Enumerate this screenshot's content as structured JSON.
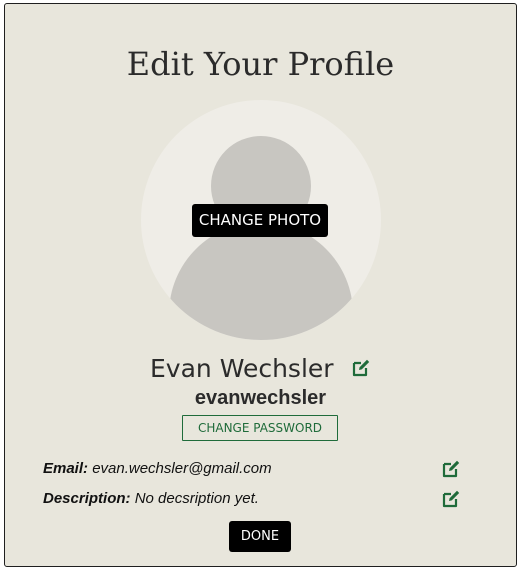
{
  "page": {
    "title": "Edit Your Profile"
  },
  "avatar": {
    "change_photo_label": "CHANGE PHOTO"
  },
  "profile": {
    "full_name": "Evan Wechsler",
    "username": "evanwechsler",
    "change_password_label": "CHANGE PASSWORD"
  },
  "fields": {
    "email_label": "Email:",
    "email_value": "evan.wechsler@gmail.com",
    "description_label": "Description:",
    "description_value": "No decsription yet."
  },
  "actions": {
    "done_label": "DONE"
  },
  "colors": {
    "background": "#e8e6dc",
    "accent_green": "#1f6b3a",
    "button_dark": "#000000"
  },
  "icons": {
    "edit": "edit-icon"
  }
}
